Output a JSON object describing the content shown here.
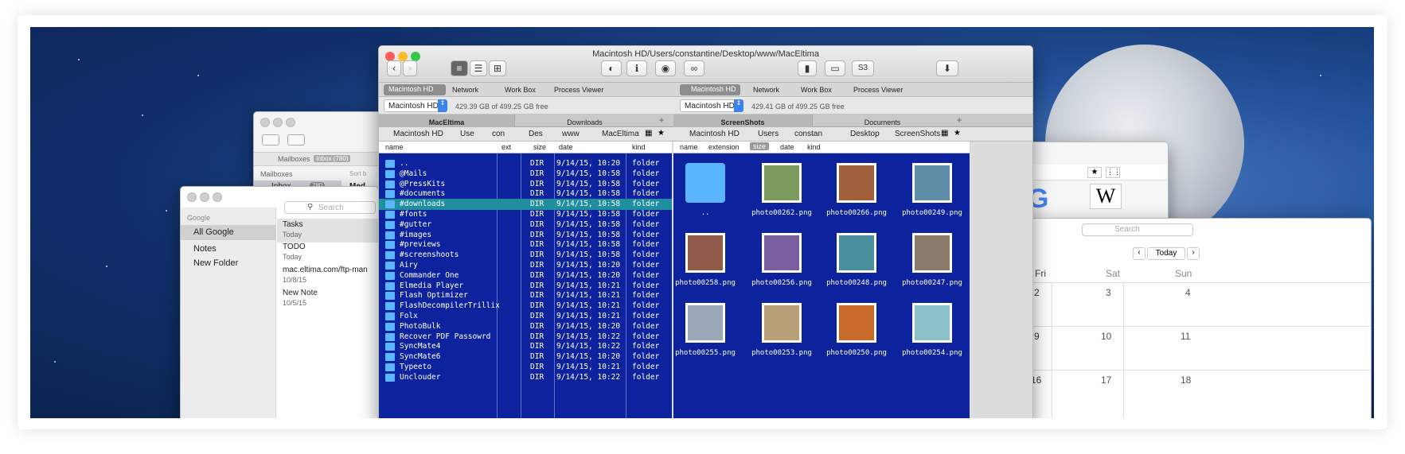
{
  "window": {
    "title": "Macintosh HD/Users/constantine/Desktop/www/MacEltima"
  },
  "toolbar": {
    "s3": "S3"
  },
  "nav": {
    "left": [
      "Macintosh HD",
      "Network",
      "Work Box",
      "Process Viewer"
    ],
    "right": [
      "Macintosh HD",
      "Network",
      "Work Box",
      "Process Viewer"
    ]
  },
  "left_pane": {
    "volume": "Macintosh HD",
    "free": "429.39 GB of 499.25 GB free",
    "tabs": [
      "MacEltima",
      "Downloads"
    ],
    "breadcrumb": [
      "Macintosh HD",
      "Use",
      "con",
      "Des",
      "www",
      "MacEltima"
    ],
    "columns": [
      "name",
      "ext",
      "size",
      "date",
      "kind"
    ],
    "rows": [
      {
        "name": "..",
        "size": "DIR",
        "date": "9/14/15, 10:20",
        "kind": "folder"
      },
      {
        "name": "@Mails",
        "size": "DIR",
        "date": "9/14/15, 10:58",
        "kind": "folder"
      },
      {
        "name": "@PressKits",
        "size": "DIR",
        "date": "9/14/15, 10:58",
        "kind": "folder"
      },
      {
        "name": "#documents",
        "size": "DIR",
        "date": "9/14/15, 10:58",
        "kind": "folder"
      },
      {
        "name": "#downloads",
        "size": "DIR",
        "date": "9/14/15, 10:58",
        "kind": "folder"
      },
      {
        "name": "#fonts",
        "size": "DIR",
        "date": "9/14/15, 10:58",
        "kind": "folder"
      },
      {
        "name": "#gutter",
        "size": "DIR",
        "date": "9/14/15, 10:58",
        "kind": "folder"
      },
      {
        "name": "#images",
        "size": "DIR",
        "date": "9/14/15, 10:58",
        "kind": "folder"
      },
      {
        "name": "#previews",
        "size": "DIR",
        "date": "9/14/15, 10:58",
        "kind": "folder"
      },
      {
        "name": "#screenshoots",
        "size": "DIR",
        "date": "9/14/15, 10:58",
        "kind": "folder"
      },
      {
        "name": "Airy",
        "size": "DIR",
        "date": "9/14/15, 10:20",
        "kind": "folder"
      },
      {
        "name": "Commander One",
        "size": "DIR",
        "date": "9/14/15, 10:20",
        "kind": "folder"
      },
      {
        "name": "Elmedia Player",
        "size": "DIR",
        "date": "9/14/15, 10:21",
        "kind": "folder"
      },
      {
        "name": "Flash Optimizer",
        "size": "DIR",
        "date": "9/14/15, 10:21",
        "kind": "folder"
      },
      {
        "name": "FlashDecompilerTrillix",
        "size": "DIR",
        "date": "9/14/15, 10:21",
        "kind": "folder"
      },
      {
        "name": "Folx",
        "size": "DIR",
        "date": "9/14/15, 10:21",
        "kind": "folder"
      },
      {
        "name": "PhotoBulk",
        "size": "DIR",
        "date": "9/14/15, 10:20",
        "kind": "folder"
      },
      {
        "name": "Recover PDF Passowrd",
        "size": "DIR",
        "date": "9/14/15, 10:22",
        "kind": "folder"
      },
      {
        "name": "SyncMate4",
        "size": "DIR",
        "date": "9/14/15, 10:22",
        "kind": "folder"
      },
      {
        "name": "SyncMate6",
        "size": "DIR",
        "date": "9/14/15, 10:20",
        "kind": "folder"
      },
      {
        "name": "Typeeto",
        "size": "DIR",
        "date": "9/14/15, 10:21",
        "kind": "folder"
      },
      {
        "name": "Unclouder",
        "size": "DIR",
        "date": "9/14/15, 10:22",
        "kind": "folder"
      }
    ],
    "selected_index": 4
  },
  "right_pane": {
    "volume": "Macintosh HD",
    "free": "429.41 GB of 499.25 GB free",
    "tabs": [
      "ScreenShots",
      "Documents"
    ],
    "breadcrumb": [
      "Macintosh HD",
      "Users",
      "constan",
      "Desktop",
      "ScreenShots"
    ],
    "sort": [
      "name",
      "extension",
      "size",
      "date",
      "kind"
    ],
    "items": [
      "..",
      "photo00262.png",
      "photo00266.png",
      "photo00249.png",
      "photo00258.png",
      "photo00256.png",
      "photo00248.png",
      "photo00247.png",
      "photo00255.png",
      "photo00253.png",
      "photo00250.png",
      "photo00254.png"
    ]
  },
  "mail": {
    "mailboxes": "Mailboxes",
    "inbox": "Inbox",
    "inbox_badge": "Inbox (780)",
    "count": "780",
    "sort": "Sort b",
    "preview": "Med"
  },
  "notes": {
    "account": "Google",
    "folders": [
      "All Google",
      "Notes",
      "New Folder"
    ],
    "search": "Search",
    "list": [
      {
        "title": "Tasks",
        "sub": "Today"
      },
      {
        "title": "TODO",
        "sub": "Today"
      },
      {
        "title": "mac.eltima.com/ftp-man",
        "sub": "10/8/15"
      },
      {
        "title": "New Note",
        "sub": "10/5/15"
      }
    ]
  },
  "calendar": {
    "search": "Search",
    "today": "Today",
    "days": [
      "Fri",
      "Sat",
      "Sun"
    ],
    "rows": [
      [
        "2",
        "3",
        "4"
      ],
      [
        "9",
        "10",
        "11"
      ],
      [
        "16",
        "17",
        "18"
      ]
    ]
  },
  "colors": {
    "pane": "#0d239e",
    "selection": "#1f8fa0",
    "folder": "#5bb5ff"
  }
}
